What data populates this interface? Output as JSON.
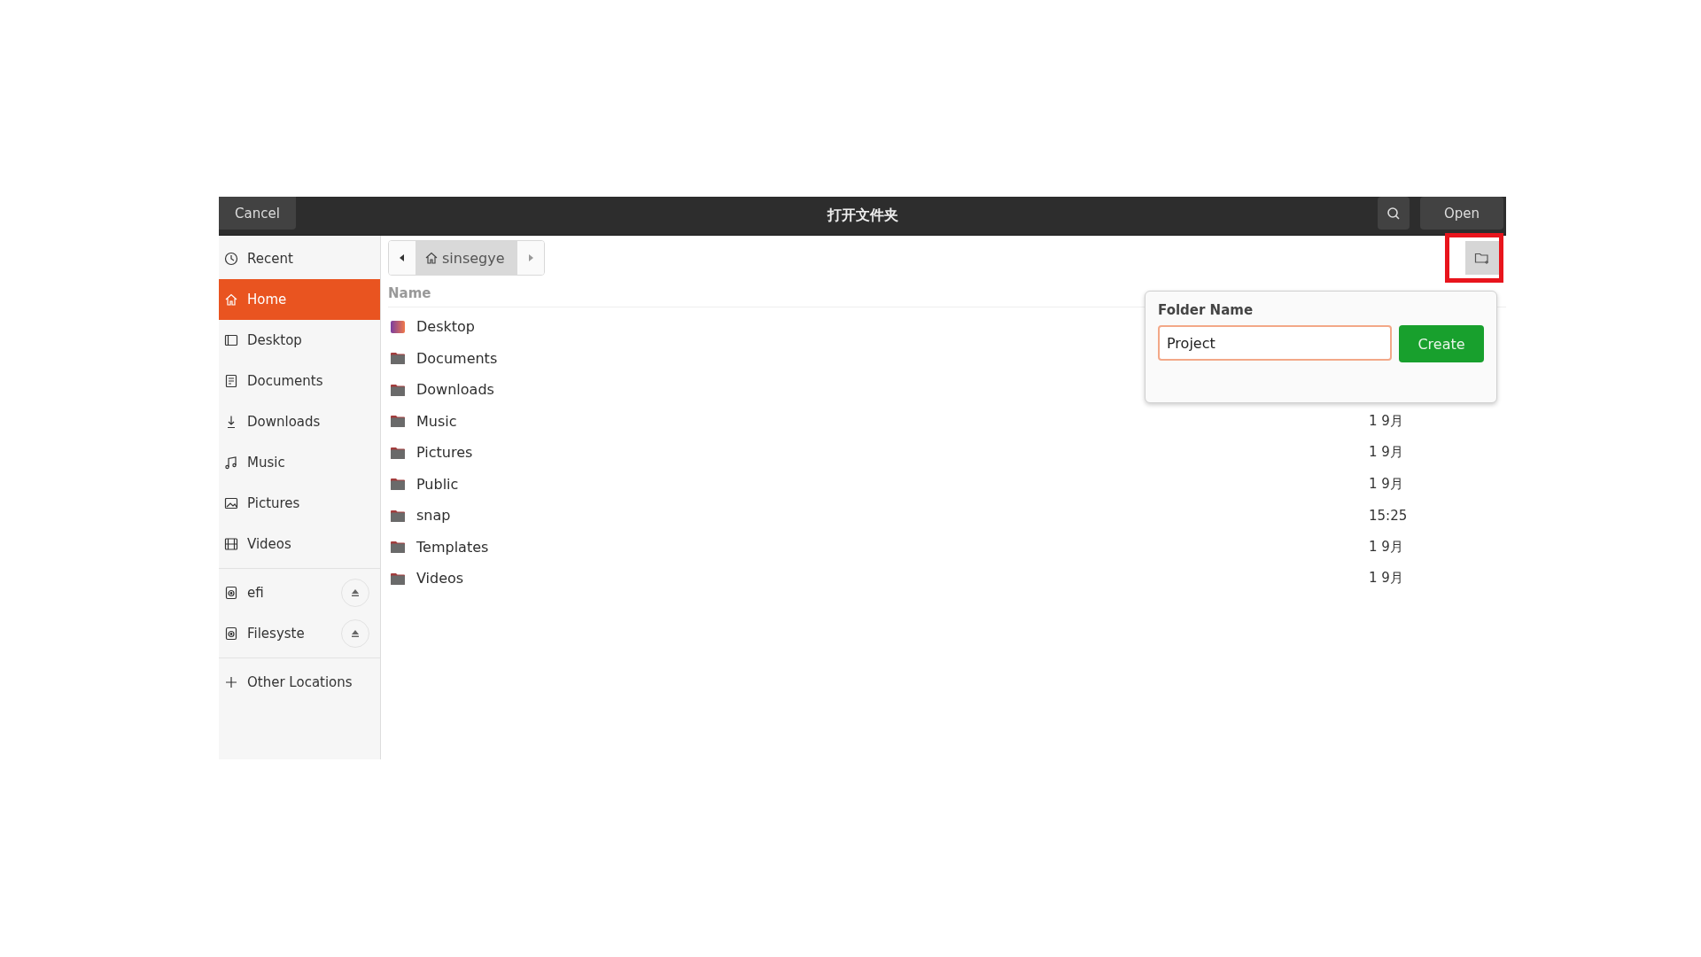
{
  "window": {
    "title": "打开文件夹",
    "cancel": "Cancel",
    "open": "Open"
  },
  "sidebar": {
    "items": [
      {
        "label": "Recent",
        "kind": "recent",
        "selected": false
      },
      {
        "label": "Home",
        "kind": "home",
        "selected": true
      },
      {
        "label": "Desktop",
        "kind": "desktop",
        "selected": false
      },
      {
        "label": "Documents",
        "kind": "documents",
        "selected": false
      },
      {
        "label": "Downloads",
        "kind": "downloads",
        "selected": false
      },
      {
        "label": "Music",
        "kind": "music",
        "selected": false
      },
      {
        "label": "Pictures",
        "kind": "pictures",
        "selected": false
      },
      {
        "label": "Videos",
        "kind": "videos",
        "selected": false
      }
    ],
    "drives": [
      {
        "label": "efi"
      },
      {
        "label": "Filesyste"
      }
    ],
    "other": {
      "label": "Other Locations"
    }
  },
  "path_bar": {
    "segments": [
      {
        "label": "sinsegye",
        "selected": true
      }
    ]
  },
  "table": {
    "columns": [
      "Name"
    ],
    "rows": [
      {
        "name": "Desktop",
        "kind": "desktop"
      },
      {
        "name": "Documents",
        "kind": "folder"
      },
      {
        "name": "Downloads",
        "kind": "folder"
      },
      {
        "name": "Music",
        "kind": "folder",
        "modified": "1 9月"
      },
      {
        "name": "Pictures",
        "kind": "folder",
        "modified": "1 9月"
      },
      {
        "name": "Public",
        "kind": "folder",
        "modified": "1 9月"
      },
      {
        "name": "snap",
        "kind": "folder",
        "modified": "15:25"
      },
      {
        "name": "Templates",
        "kind": "folder",
        "modified": "1 9月"
      },
      {
        "name": "Videos",
        "kind": "folder",
        "modified": "1 9月"
      }
    ]
  },
  "new_folder_popover": {
    "label": "Folder Name",
    "value": "Project",
    "button": "Create"
  }
}
